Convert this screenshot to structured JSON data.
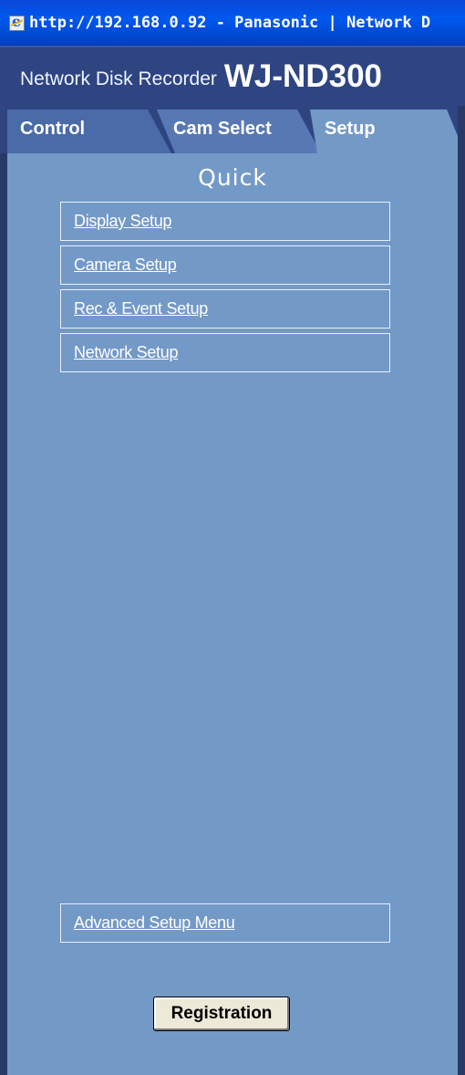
{
  "window": {
    "title": "http://192.168.0.92 - Panasonic | Network D",
    "icon": "ie-page-icon"
  },
  "header": {
    "product_line": "Network Disk Recorder",
    "model": "WJ-ND300"
  },
  "tabs": [
    {
      "label": "Control",
      "active": false
    },
    {
      "label": "Cam Select",
      "active": false
    },
    {
      "label": "Setup",
      "active": true
    }
  ],
  "setup": {
    "section_title": "Quick",
    "links": [
      {
        "label": "Display Setup"
      },
      {
        "label": "Camera Setup"
      },
      {
        "label": "Rec & Event Setup"
      },
      {
        "label": "Network Setup"
      }
    ],
    "advanced_link": "Advanced Setup Menu",
    "register_button": "Registration"
  },
  "colors": {
    "titlebar": "#0058ee",
    "header_bg": "#2e4582",
    "panel_bg": "#7399c7",
    "button_bg": "#ece9d8"
  }
}
